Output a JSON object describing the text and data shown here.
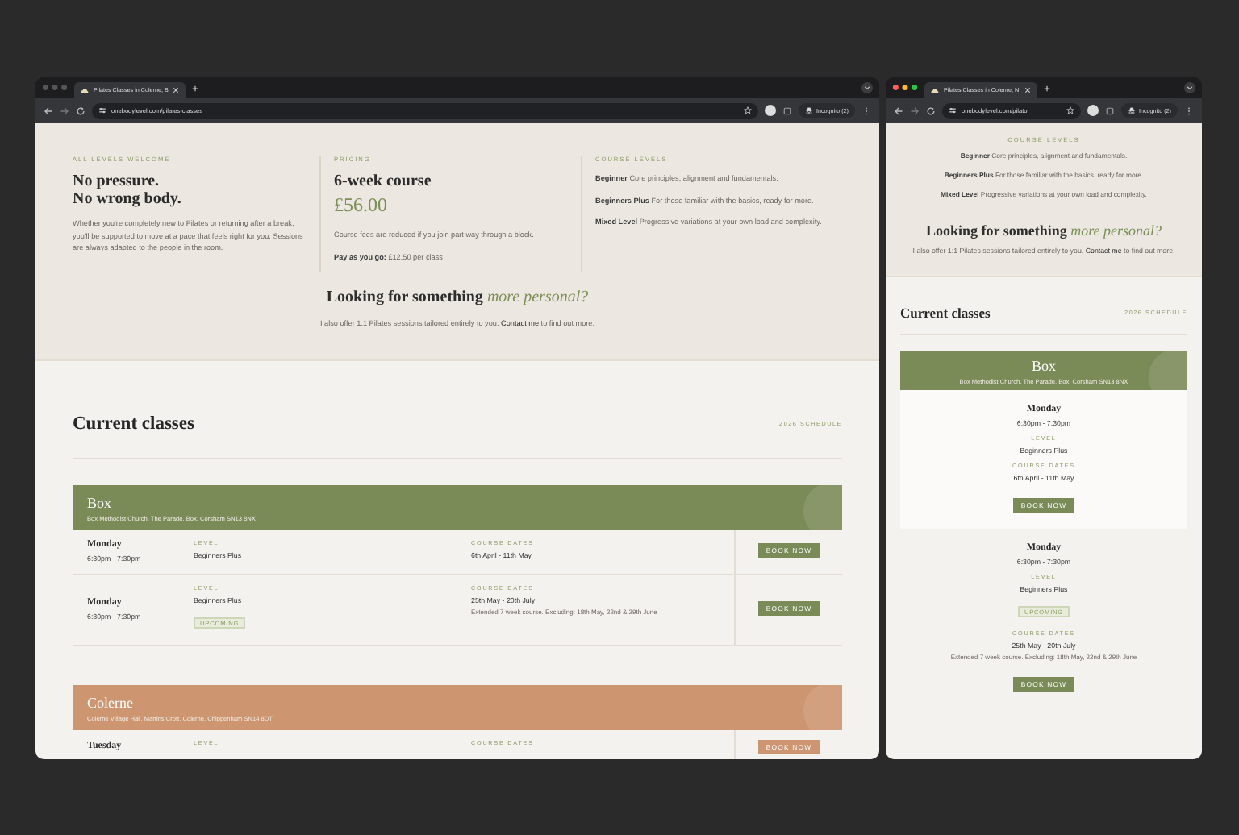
{
  "windows": [
    {
      "kind": "wide",
      "active": false,
      "tab_title": "Pilates Classes in Colerne, B",
      "url": "onebodylevel.com/pilates-classes",
      "incognito": "Incognito (2)",
      "intro_columns": [
        {
          "kind": "text",
          "eyebrow": "ALL LEVELS WELCOME",
          "heading": "No pressure.\nNo wrong body.",
          "body": "Whether you're completely new to Pilates or returning after a break, you'll be supported to move at a pace that feels right for you. Sessions are always adapted to the people in the room."
        },
        {
          "kind": "pricing",
          "eyebrow": "PRICING",
          "heading": "6-week course",
          "price": "£56.00",
          "notes": [
            "Course fees are reduced if you join part way through a block.",
            "**Pay as you go:** £12.50 per class"
          ]
        },
        {
          "kind": "levels",
          "eyebrow": "COURSE LEVELS",
          "levels": [
            "**Beginner** Core principles, alignment and fundamentals.",
            "**Beginners Plus** For those familiar with the basics, ready for more.",
            "**Mixed Level** Progressive variations at your own load and complexity."
          ]
        }
      ],
      "personal": {
        "heading": "Looking for something *more personal?*",
        "before": "I also offer 1:1 Pilates sessions tailored entirely to you.",
        "link": "Contact me",
        "after": "to find out more."
      },
      "classes": {
        "title": "Current classes",
        "schedule": "2026 SCHEDULE",
        "locations": [
          {
            "name": "Box",
            "address": "Box Methodist Church, The Parade, Box, Corsham SN13 8NX",
            "color": "#7b8b58",
            "sessions": [
              {
                "day": "Monday",
                "time": "6:30pm - 7:30pm",
                "level_label": "LEVEL",
                "level": "Beginners Plus",
                "dates_label": "COURSE DATES",
                "dates": "6th April - 11th May",
                "button": "BOOK NOW"
              },
              {
                "day": "Monday",
                "time": "6:30pm - 7:30pm",
                "level_label": "LEVEL",
                "level": "Beginners Plus",
                "badge": "UPCOMING",
                "dates_label": "COURSE DATES",
                "dates": "25th May - 20th July",
                "note": "Extended 7 week course. Excluding: 18th May, 22nd & 29th June",
                "button": "BOOK NOW"
              }
            ]
          },
          {
            "name": "Colerne",
            "address": "Colerne Village Hall, Martins Croft, Colerne, Chippenham SN14 8DT",
            "color": "#cd9670",
            "sessions": [
              {
                "day": "Tuesday",
                "level_label": "LEVEL",
                "dates_label": "COURSE DATES",
                "button": "BOOK NOW"
              }
            ]
          }
        ]
      }
    },
    {
      "kind": "narrow",
      "active": true,
      "tab_title": "Pilates Classes in Colerne, N",
      "url": "onebodylevel.com/pilato",
      "incognito": "Incognito (2)",
      "intro_columns": [
        {
          "kind": "levels",
          "eyebrow": "COURSE LEVELS",
          "levels": [
            "**Beginner** Core principles, alignment and fundamentals.",
            "**Beginners Plus** For those familiar with the basics, ready for more.",
            "**Mixed Level** Progressive variations at your own load and complexity."
          ]
        }
      ],
      "personal": {
        "heading": "Looking for something *more personal?*",
        "before": "I also offer 1:1 Pilates sessions tailored entirely to you.",
        "link": "Contact me",
        "after": "to find out more."
      },
      "classes": {
        "title": "Current classes",
        "schedule": "2026 SCHEDULE",
        "locations": [
          {
            "name": "Box",
            "address": "Box Methodist Church, The Parade, Box, Corsham SN13 8NX",
            "color": "#7b8b58",
            "sessions": [
              {
                "day": "Monday",
                "time": "6:30pm - 7:30pm",
                "level_label": "LEVEL",
                "level": "Beginners Plus",
                "dates_label": "COURSE DATES",
                "dates": "6th April - 11th May",
                "button": "BOOK NOW"
              },
              {
                "day": "Monday",
                "time": "6:30pm - 7:30pm",
                "level_label": "LEVEL",
                "level": "Beginners Plus",
                "badge": "UPCOMING",
                "dates_label": "COURSE DATES",
                "dates": "25th May - 20th July",
                "note": "Extended 7 week course. Excluding: 18th May, 22nd & 29th June",
                "button": "BOOK NOW"
              }
            ]
          }
        ]
      }
    }
  ]
}
